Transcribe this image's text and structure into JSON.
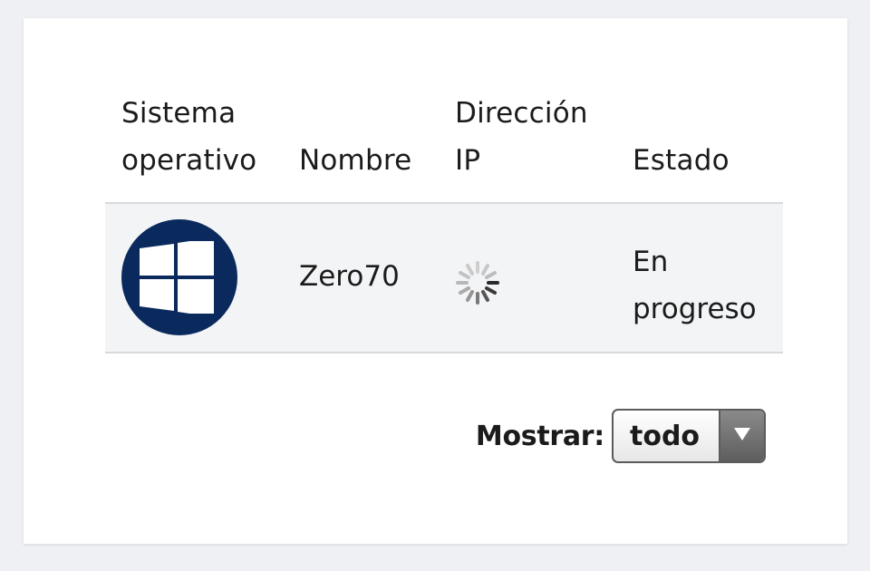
{
  "table": {
    "headers": {
      "os_line1": "Sistema",
      "os_line2": "operativo",
      "name": "Nombre",
      "ip_line1": "Dirección",
      "ip_line2": "IP",
      "state": "Estado"
    },
    "rows": [
      {
        "os_icon": "windows-icon",
        "name": "Zero70",
        "ip_icon": "loading-spinner-icon",
        "state_line1": "En",
        "state_line2": "progreso"
      }
    ]
  },
  "filter": {
    "label": "Mostrar:",
    "selected": "todo"
  },
  "colors": {
    "os_badge": "#0a2a5e",
    "row_background": "#f3f4f6",
    "page_background": "#eef0f3",
    "divider": "#d7d9dc"
  }
}
